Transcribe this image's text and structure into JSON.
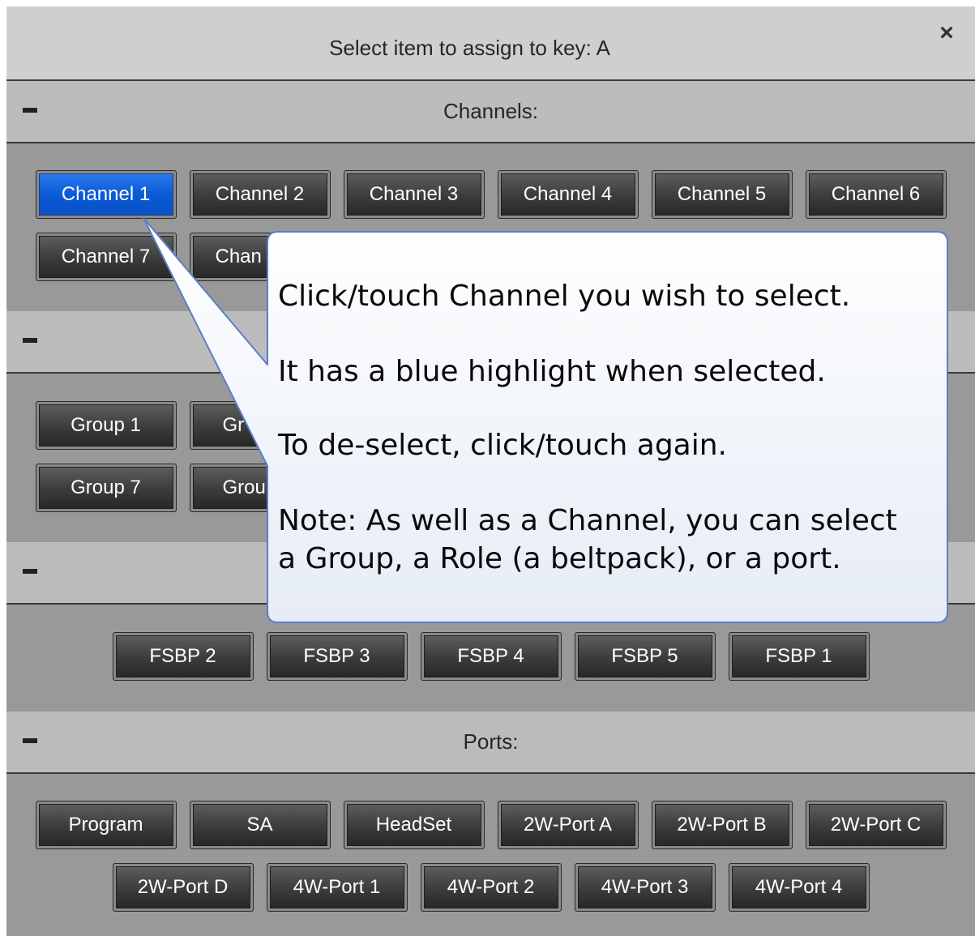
{
  "dialog": {
    "title": "Select item to assign to key: A",
    "close_icon": "×"
  },
  "sections": {
    "channels": {
      "title": "Channels:",
      "row1": [
        "Channel 1",
        "Channel 2",
        "Channel 3",
        "Channel 4",
        "Channel 5",
        "Channel 6"
      ],
      "row2": [
        "Channel 7",
        "Chan"
      ],
      "selected": "Channel 1"
    },
    "groups": {
      "title": "",
      "row1": [
        "Group 1",
        "Gr"
      ],
      "row2": [
        "Group 7",
        "Grou"
      ]
    },
    "roles": {
      "title": "",
      "row1": [
        "FSBP 2",
        "FSBP 3",
        "FSBP 4",
        "FSBP 5",
        "FSBP 1"
      ]
    },
    "ports": {
      "title": "Ports:",
      "row1": [
        "Program",
        "SA",
        "HeadSet",
        "2W-Port A",
        "2W-Port B",
        "2W-Port C"
      ],
      "row2": [
        "2W-Port D",
        "4W-Port 1",
        "4W-Port 2",
        "4W-Port 3",
        "4W-Port 4"
      ]
    }
  },
  "tooltip": {
    "line1": "Click/touch Channel you wish to select.",
    "line2": "It has a blue highlight when selected.",
    "line3": "To de-select, click/touch again.",
    "line4a": "Note: As well as a Channel, you can select",
    "line4b": "a Group, a Role (a beltpack), or a port."
  },
  "colors": {
    "selected_button": "#0a5ad6",
    "button": "#3d3d3d",
    "header": "#bcbcbc",
    "body": "#999999"
  }
}
